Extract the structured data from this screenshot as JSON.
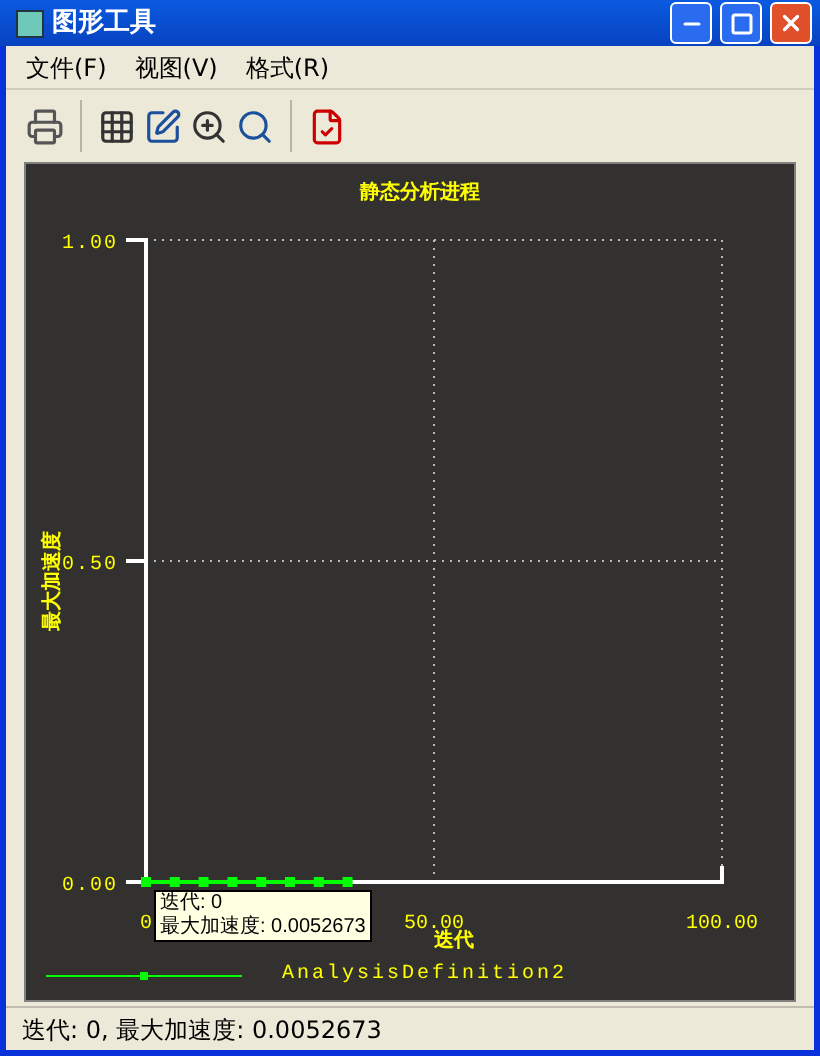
{
  "window": {
    "title": "图形工具"
  },
  "menu": [
    {
      "label": "文件(F)"
    },
    {
      "label": "视图(V)"
    },
    {
      "label": "格式(R)"
    }
  ],
  "chart": {
    "chart_data": {
      "type": "line",
      "title": "静态分析进程",
      "xlabel": "迭代",
      "ylabel": "最大加速度",
      "x": [
        0,
        5,
        10,
        15,
        20,
        25,
        30,
        35
      ],
      "series": [
        {
          "name": "AnalysisDefinition2",
          "color": "#00ff00",
          "marker": "square",
          "values": [
            0,
            0,
            0,
            0,
            0,
            0,
            0,
            0
          ]
        }
      ],
      "xlim": [
        0,
        100
      ],
      "ylim": [
        0,
        1
      ],
      "xticks": [
        {
          "value": 0,
          "label": "0"
        },
        {
          "value": 50,
          "label": "50.00"
        },
        {
          "value": 100,
          "label": "100.00"
        }
      ],
      "yticks": [
        {
          "value": 0,
          "label": "0.00"
        },
        {
          "value": 0.5,
          "label": "0.50"
        },
        {
          "value": 1,
          "label": "1.00"
        }
      ]
    },
    "tooltip": [
      "迭代: 0",
      "最大加速度: 0.0052673"
    ]
  },
  "status_bar": "迭代: 0, 最大加速度: 0.0052673"
}
